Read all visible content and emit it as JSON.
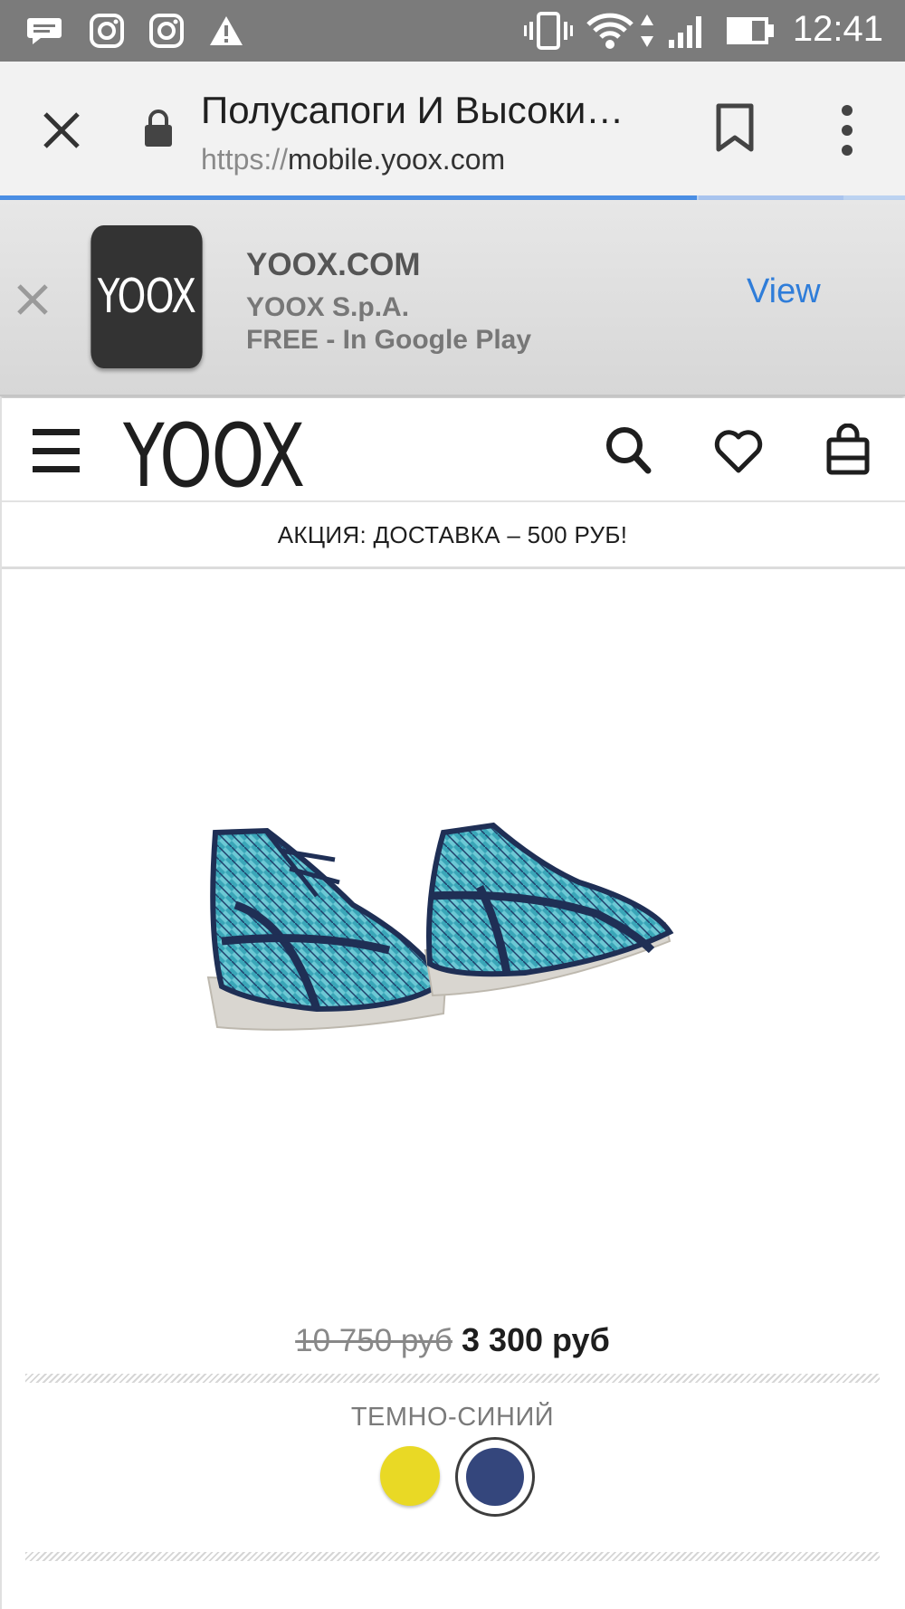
{
  "status_bar": {
    "time": "12:41",
    "icons": [
      "message-icon",
      "instagram-icon",
      "instagram-icon",
      "warning-icon",
      "vibrate-icon",
      "wifi-icon",
      "data-arrows-icon",
      "signal-icon",
      "battery-icon"
    ]
  },
  "toolbar": {
    "title": "Полусапоги И Высоки…",
    "url_scheme": "https://",
    "url_host": "mobile.yoox.com",
    "page_load_progress": 0.77
  },
  "app_banner": {
    "logo_text": "YOOX",
    "app_name": "YOOX.COM",
    "developer": "YOOX S.p.A.",
    "price_text": "FREE - In Google Play",
    "view_label": "View"
  },
  "header": {
    "logo_text": "YOOX"
  },
  "promo": {
    "text": "АКЦИЯ: ДОСТАВКА – 500 РУБ!"
  },
  "product": {
    "old_price": "10 750 руб",
    "new_price": "3 300 руб",
    "selected_color": "ТЕМНО-СИНИЙ",
    "swatch_colors": [
      "#e9d925",
      "#34467c"
    ]
  }
}
